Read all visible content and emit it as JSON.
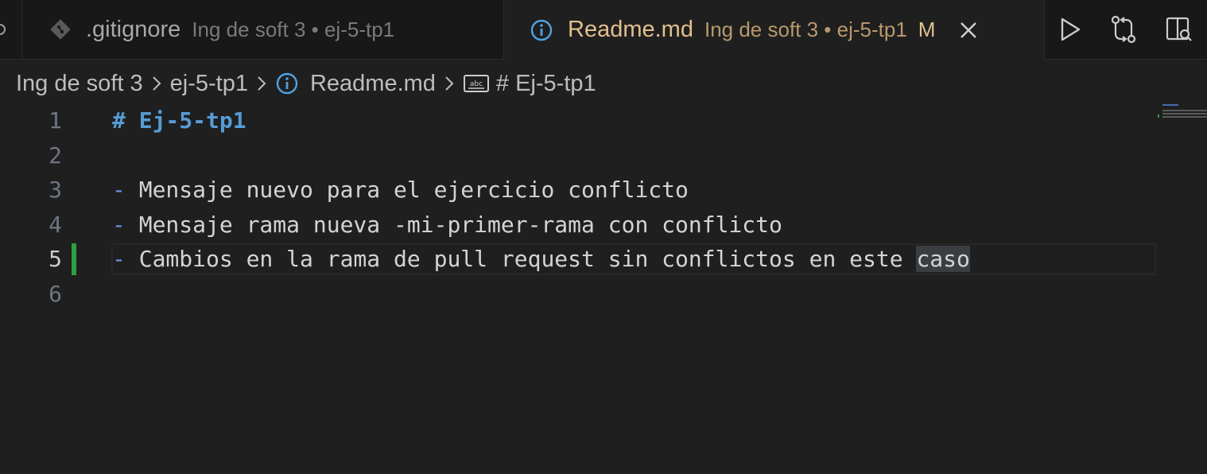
{
  "tabs": [
    {
      "name": ".gitignore",
      "description": "Ing de soft 3 • ej-5-tp1",
      "icon": "git-icon",
      "active": false
    },
    {
      "name": "Readme.md",
      "description": "Ing de soft 3 • ej-5-tp1",
      "badge": "M",
      "icon": "info-icon",
      "active": true
    }
  ],
  "actions": [
    "run-icon",
    "compare-changes-icon",
    "preview-icon"
  ],
  "breadcrumb": [
    "Ing de soft 3",
    "ej-5-tp1",
    "Readme.md",
    "# Ej-5-tp1"
  ],
  "editor": {
    "active_line": 5,
    "lines": [
      {
        "number": "1",
        "bullet": "",
        "text": "# Ej-5-tp1",
        "highlight": ""
      },
      {
        "number": "2",
        "bullet": "",
        "text": "",
        "highlight": ""
      },
      {
        "number": "3",
        "bullet": "-",
        "text": " Mensaje nuevo para el ejercicio conflicto",
        "highlight": ""
      },
      {
        "number": "4",
        "bullet": "-",
        "text": " Mensaje rama nueva -mi-primer-rama con conflicto",
        "highlight": ""
      },
      {
        "number": "5",
        "bullet": "-",
        "text": " Cambios en la rama de pull request sin conflictos en este ",
        "highlight": "caso"
      },
      {
        "number": "6",
        "bullet": "",
        "text": "",
        "highlight": ""
      }
    ]
  },
  "colors": {
    "accent_tab_text": "#e2c08d",
    "heading": "#569cd6",
    "gutter_modified": "#2ea043",
    "background": "#1f1f1f"
  }
}
